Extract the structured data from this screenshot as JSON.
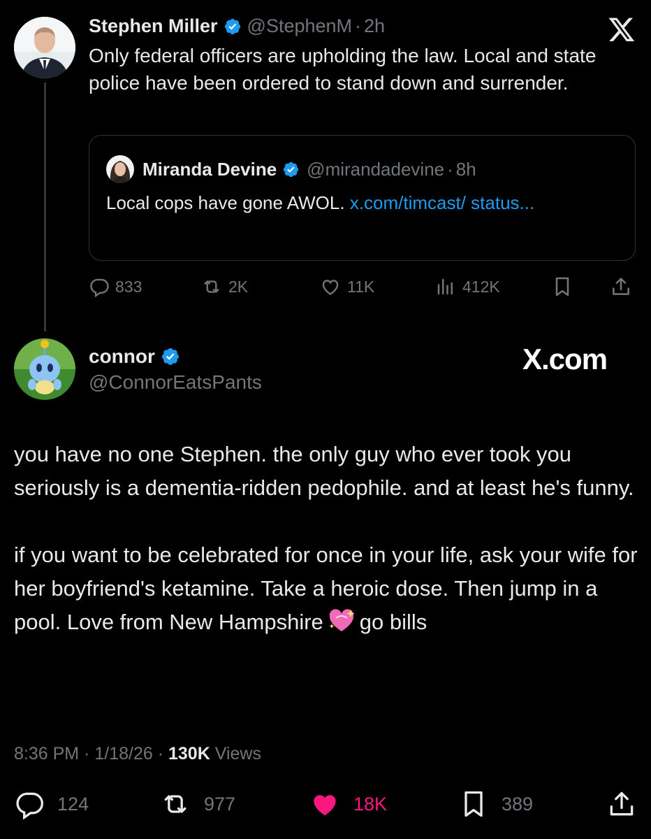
{
  "parent": {
    "name": "Stephen Miller",
    "handle": "@StephenM",
    "time": "2h",
    "text": "Only federal officers are upholding the law. Local and state police have been ordered to stand down and surrender.",
    "quote": {
      "name": "Miranda Devine",
      "handle": "@mirandadevine",
      "time": "8h",
      "text": "Local cops have gone AWOL.",
      "link": "x.com/timcast/ status..."
    },
    "actions": {
      "replies": "833",
      "reposts": "2K",
      "likes": "11K",
      "views": "412K"
    }
  },
  "reply": {
    "name": "connor",
    "handle": "@ConnorEatsPants",
    "watermark": "X.com",
    "paragraphs": [
      "you have no one Stephen. the only guy who ever took you seriously is a dementia-ridden pedophile. and at least he's funny.",
      "if you want to be celebrated for once in your life, ask your wife for her boyfriend's ketamine. Take a heroic dose. Then jump in a pool. Love from New Hampshire",
      "go bills"
    ],
    "meta": {
      "time": "8:36 PM",
      "date": "1/18/26",
      "views_count": "130K",
      "views_label": "Views"
    },
    "actions": {
      "replies": "124",
      "reposts": "977",
      "likes": "18K",
      "bookmarks": "389"
    }
  },
  "colors": {
    "background": "#000000",
    "text": "#e7e9ea",
    "muted": "#71767b",
    "link": "#1d9bf0",
    "verified": "#1d9bf0",
    "like": "#f91880"
  },
  "icons": [
    "verified-badge-icon",
    "x-logo-icon",
    "reply-icon",
    "repost-icon",
    "like-icon",
    "views-icon",
    "bookmark-icon",
    "share-icon",
    "sparkling-heart-emoji"
  ]
}
